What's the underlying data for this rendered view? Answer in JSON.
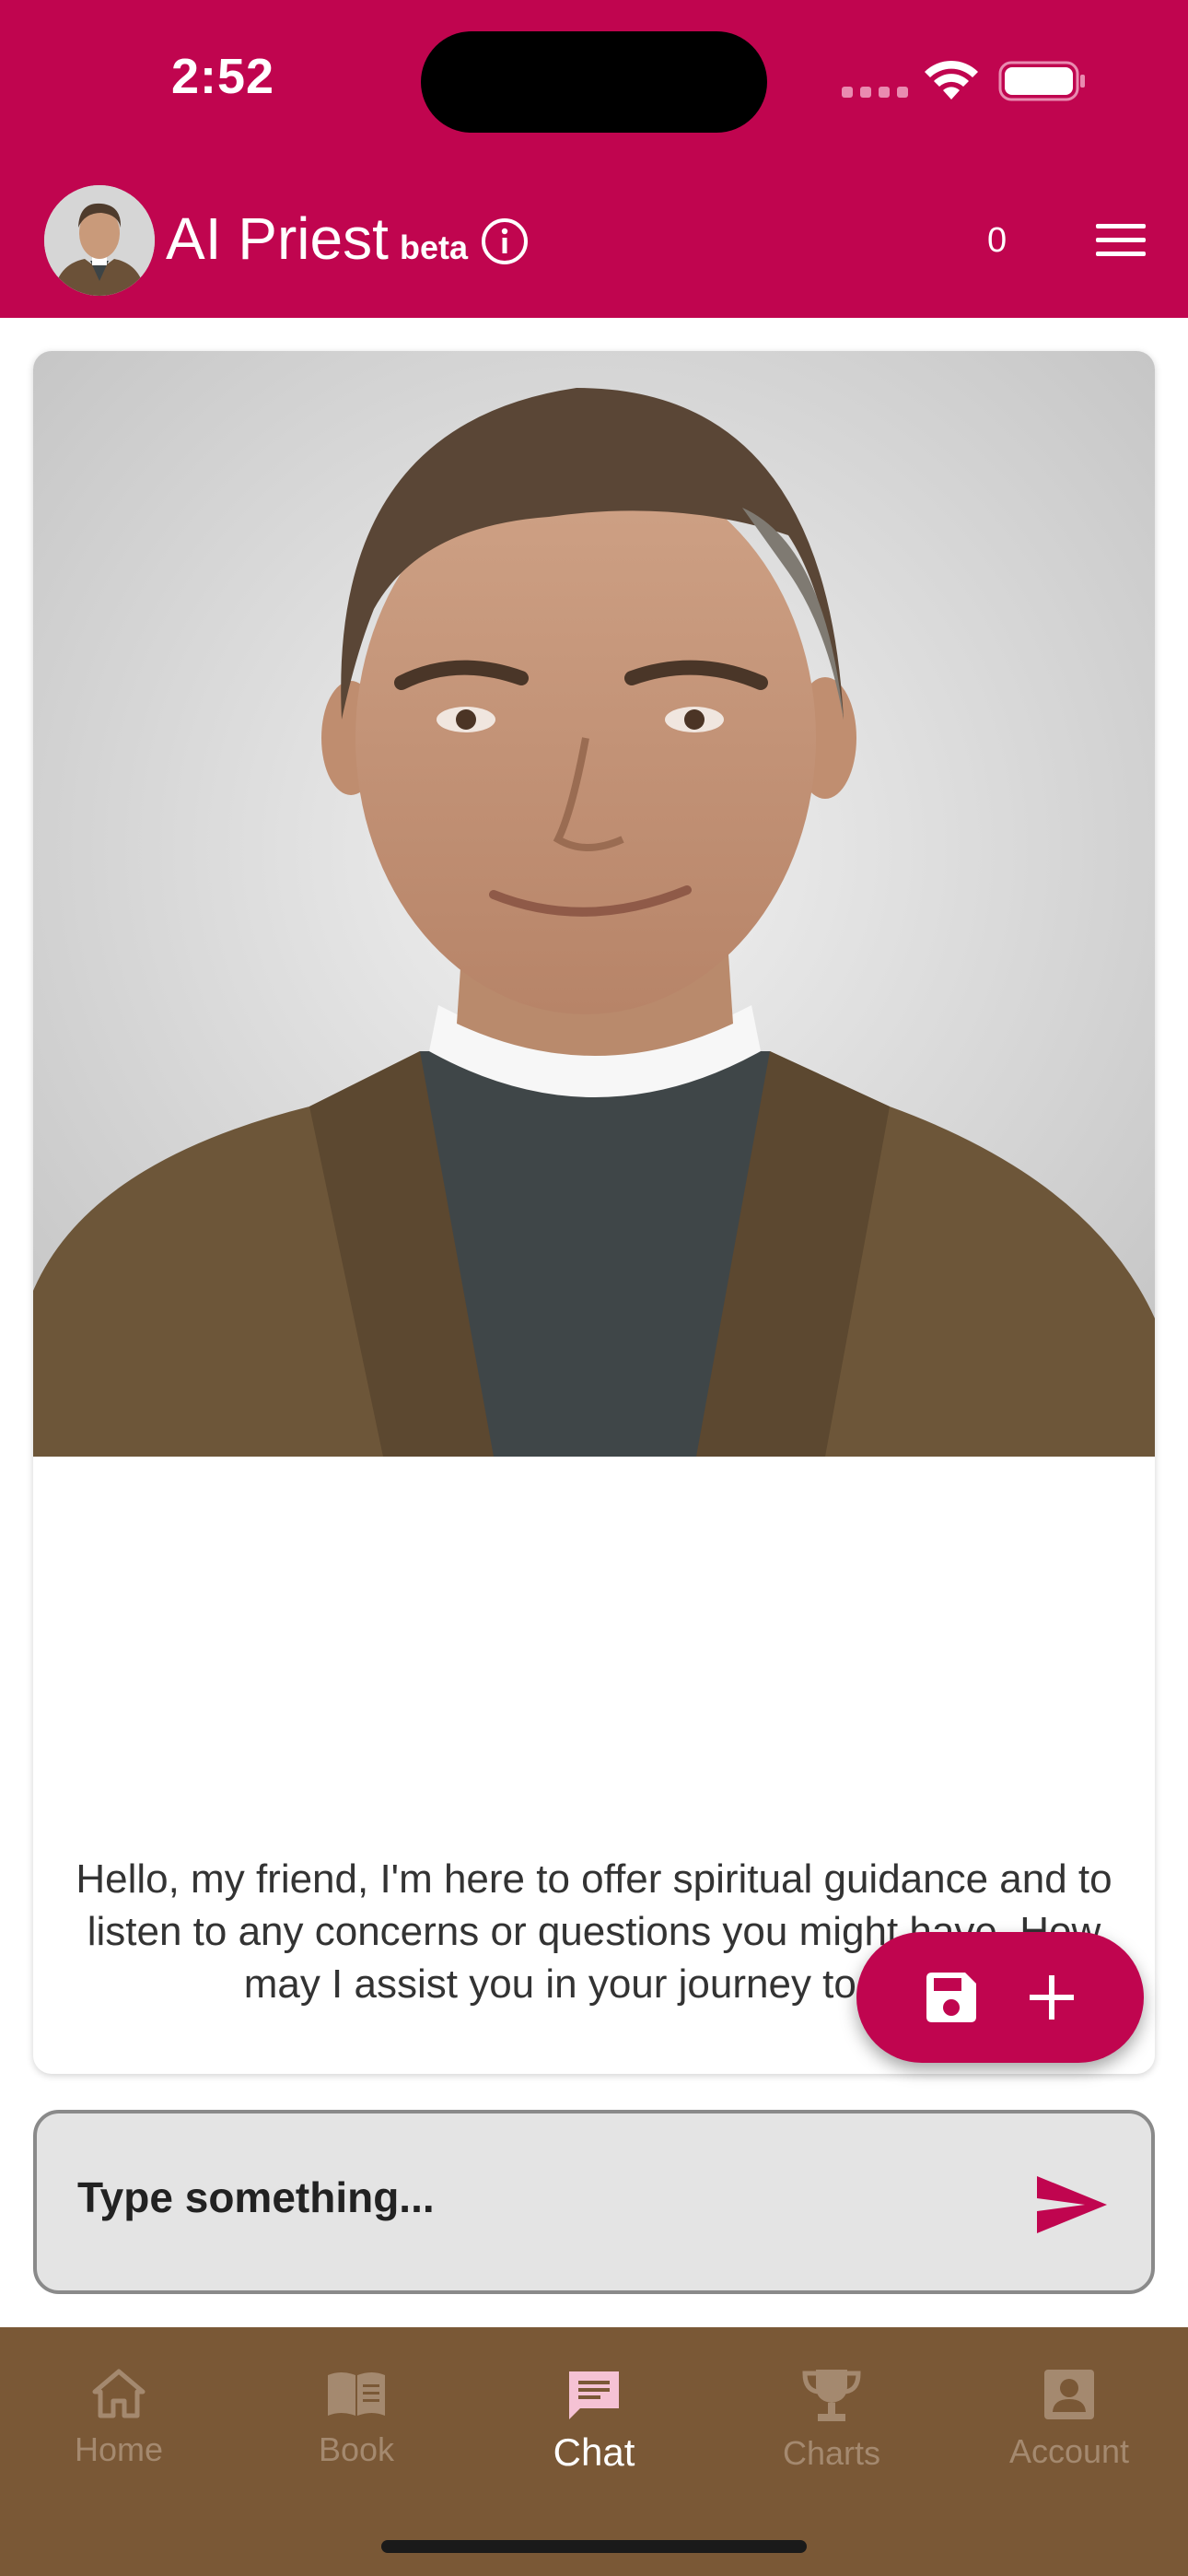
{
  "status_bar": {
    "time": "2:52",
    "icons": [
      "signal-dots-icon",
      "wifi-icon",
      "battery-icon"
    ]
  },
  "app_bar": {
    "title": "AI Priest",
    "badge": "beta",
    "credit_count": "0",
    "icons": [
      "priest-avatar",
      "info-icon",
      "hamburger-menu-icon"
    ]
  },
  "chat": {
    "greeting": "Hello, my friend, I'm here to offer spiritual guidance and to listen to any concerns or questions you might have. How may I assist you in your journey today?",
    "portrait": "priest-portrait"
  },
  "fab": {
    "icons": [
      "save-icon",
      "plus-icon"
    ]
  },
  "input": {
    "placeholder": "Type something...",
    "send_icon": "send-icon"
  },
  "bottom_nav": {
    "items": [
      {
        "label": "Home",
        "icon": "home-icon"
      },
      {
        "label": "Book",
        "icon": "book-icon"
      },
      {
        "label": "Chat",
        "icon": "chat-icon",
        "active": true
      },
      {
        "label": "Charts",
        "icon": "trophy-icon"
      },
      {
        "label": "Account",
        "icon": "account-icon"
      }
    ]
  },
  "colors": {
    "primary": "#c0054f",
    "nav_background": "#7a5836",
    "nav_inactive": "#a4896f",
    "nav_active": "#ffffff"
  }
}
